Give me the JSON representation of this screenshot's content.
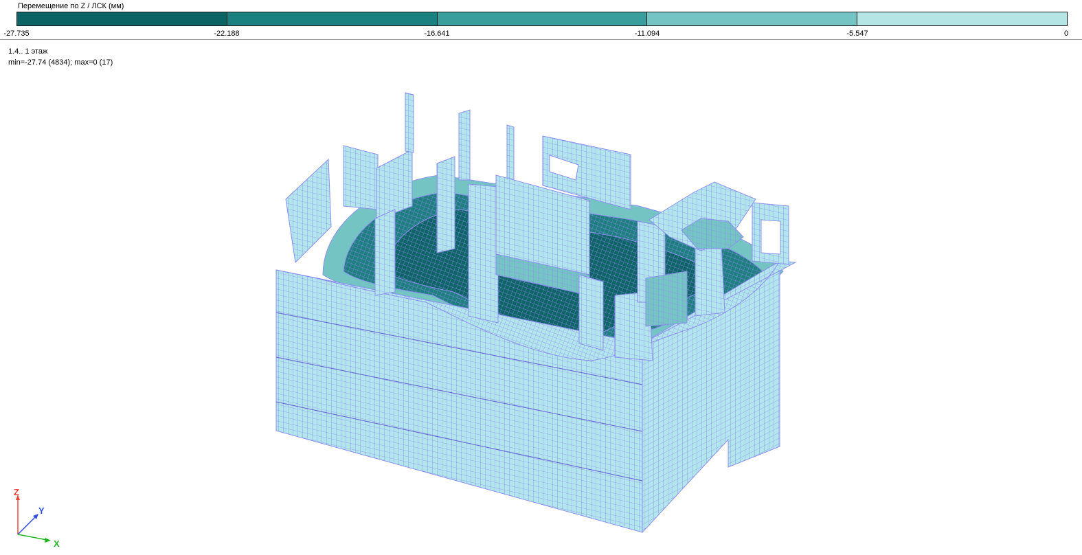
{
  "legend": {
    "title": "Перемещение по Z / ЛСК (мм)",
    "colors": [
      "#0b6363",
      "#1a8180",
      "#3a9e9c",
      "#75c4c4",
      "#b6e5e6"
    ],
    "ticks": [
      "-27.735",
      "-22.188",
      "-16.641",
      "-11.094",
      "-5.547",
      "0"
    ]
  },
  "info": {
    "case": "1.4.. 1 этаж",
    "range": "min=-27.74 (4834); max=0 (17)"
  },
  "axes": {
    "z": "Z",
    "y": "Y",
    "x": "X",
    "colors": {
      "z": "#e8453c",
      "y": "#2f4fe0",
      "x": "#1fb51f"
    }
  },
  "model": {
    "fill_light": "#b3e6ec",
    "fill_mid": "#75c4c4",
    "fill_dark": "#1f7f80",
    "fill_darkest": "#0e6466",
    "mesh": "#8c8ff0"
  }
}
